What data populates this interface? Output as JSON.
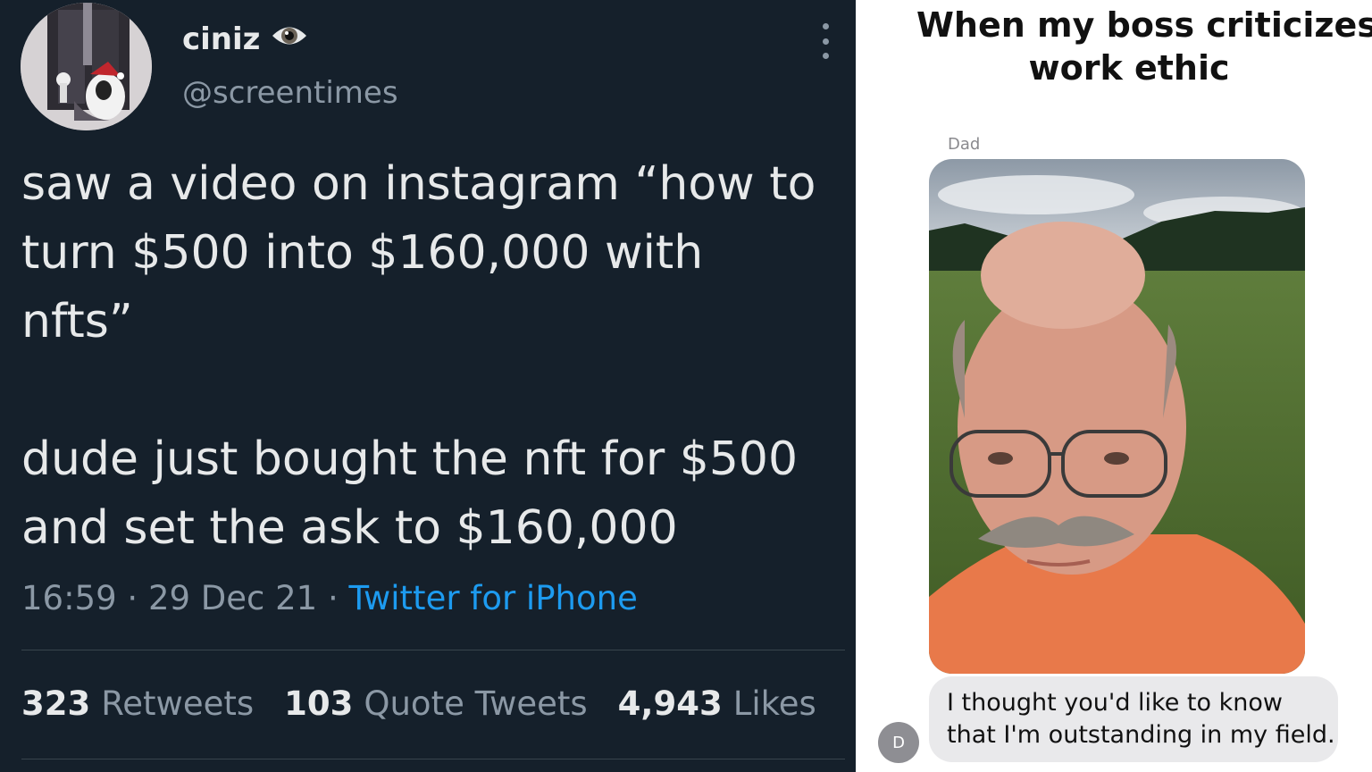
{
  "tweet": {
    "display_name": "ciniz",
    "name_badge_icon": "eye-icon",
    "handle": "@screentimes",
    "more_icon": "more-vertical-icon",
    "text": "saw a video on instagram “how to\nturn $500 into $160,000 with\nnfts”\n\ndude just bought the nft for $500\nand set the ask to $160,000",
    "time": "16:59",
    "date": "29 Dec 21",
    "source": "Twitter for iPhone",
    "stats": [
      {
        "number": "323",
        "label": "Retweets"
      },
      {
        "number": "103",
        "label": "Quote Tweets"
      },
      {
        "number": "4,943",
        "label": "Likes"
      }
    ],
    "colors": {
      "background": "#15202b",
      "text": "#e7e9ea",
      "muted": "#8b98a5",
      "link": "#1d9bf0"
    }
  },
  "meme": {
    "caption_line1": "When my boss criticizes my",
    "caption_line2": "work ethic",
    "sender_name": "Dad",
    "photo_icon": "photo-of-man-in-field",
    "message": "I thought you'd like to know\nthat I'm outstanding in my field.",
    "sender_initial": "D",
    "colors": {
      "bubble": "#e9e9eb",
      "initial_avatar": "#8e8e93"
    }
  }
}
